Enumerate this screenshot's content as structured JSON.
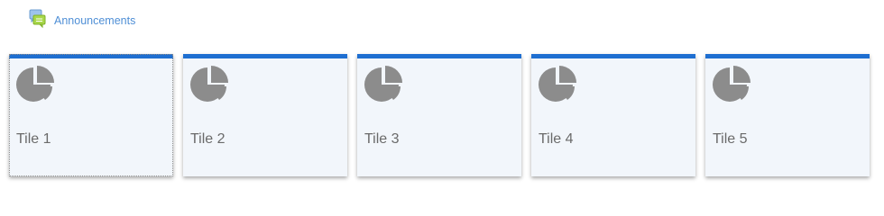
{
  "announcements": {
    "label": "Announcements",
    "icon": "chat-bubbles-icon"
  },
  "tiles": [
    {
      "label": "Tile 1",
      "icon": "pie-chart-icon"
    },
    {
      "label": "Tile 2",
      "icon": "pie-chart-icon"
    },
    {
      "label": "Tile 3",
      "icon": "pie-chart-icon"
    },
    {
      "label": "Tile 4",
      "icon": "pie-chart-icon"
    },
    {
      "label": "Tile 5",
      "icon": "pie-chart-icon"
    }
  ],
  "colors": {
    "accent": "#1f6fd1",
    "link": "#4f8fd6",
    "tile_background": "#f2f6fb",
    "icon_gray": "#8c8c8c",
    "label_gray": "#6a6a6a"
  }
}
